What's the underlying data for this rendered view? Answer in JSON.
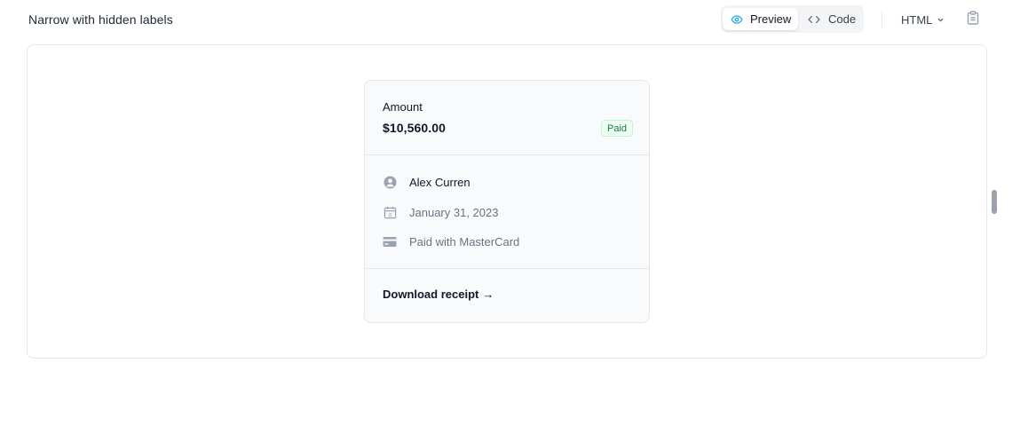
{
  "header": {
    "title": "Narrow with hidden labels",
    "tabs": [
      {
        "label": "Preview",
        "icon": "eye-icon",
        "active": true
      },
      {
        "label": "Code",
        "icon": "code-icon",
        "active": false
      }
    ],
    "language": "HTML",
    "copy_icon": "clipboard-icon"
  },
  "colors": {
    "accent": "#0ea5e9",
    "paid_badge_text": "#15803d",
    "paid_badge_bg": "#f0fdf4",
    "card_bg": "#f9fafb",
    "muted_text": "#6b7280",
    "border": "#e5e7eb"
  },
  "card": {
    "amount_label": "Amount",
    "amount_value": "$10,560.00",
    "status": "Paid",
    "details": [
      {
        "icon": "user-circle-icon",
        "text": "Alex Curren"
      },
      {
        "icon": "calendar-icon",
        "text": "January 31, 2023"
      },
      {
        "icon": "credit-card-icon",
        "text": "Paid with MasterCard"
      }
    ],
    "download_label": "Download receipt",
    "download_arrow": "→"
  }
}
